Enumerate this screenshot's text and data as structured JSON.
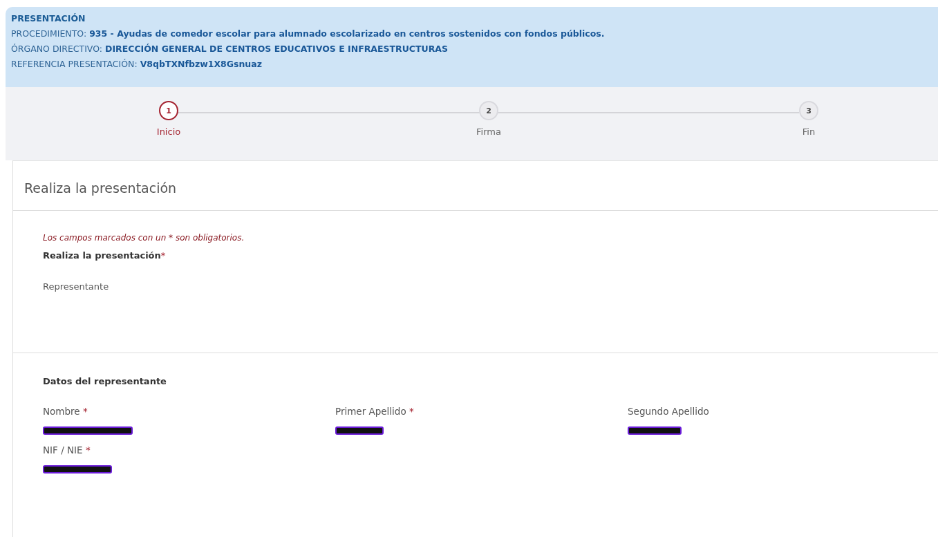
{
  "header": {
    "title": "PRESENTACIÓN",
    "lines": [
      {
        "label": "PROCEDIMIENTO:",
        "value": "935 - Ayudas de comedor escolar para alumnado escolarizado en centros sostenidos con fondos públicos."
      },
      {
        "label": "ÓRGANO DIRECTIVO:",
        "value": "DIRECCIÓN GENERAL DE CENTROS EDUCATIVOS E INFRAESTRUCTURAS"
      },
      {
        "label": "REFERENCIA PRESENTACIÓN:",
        "value": "V8qbTXNfbzw1X8Gsnuaz"
      }
    ]
  },
  "steps": [
    {
      "number": "1",
      "label": "Inicio",
      "selected": true
    },
    {
      "number": "2",
      "label": "Firma",
      "selected": false
    },
    {
      "number": "3",
      "label": "Fin",
      "selected": false
    }
  ],
  "card": {
    "title": "Realiza la presentación",
    "note": "Los campos marcados con un * son obligatorios.",
    "question": {
      "label": "Realiza la presentación",
      "required_mark": "*",
      "value": "Representante"
    },
    "section": {
      "title": "Datos del representante",
      "fields": [
        {
          "label": "Nombre",
          "required_mark": "*",
          "redacted": true
        },
        {
          "label": "Primer Apellido",
          "required_mark": "*",
          "redacted": true
        },
        {
          "label": "Segundo Apellido",
          "redacted": true
        },
        {
          "label": "NIF / NIE",
          "required_mark": "*",
          "redacted": true
        }
      ]
    }
  }
}
